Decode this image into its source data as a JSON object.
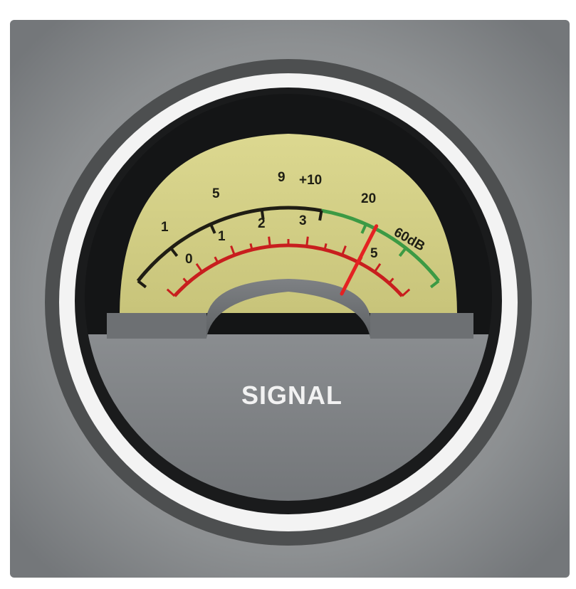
{
  "panel": {
    "caption": "SIGNAL"
  },
  "meter": {
    "db_scale": {
      "labels": [
        "1",
        "5",
        "9",
        "+10",
        "20",
        "60dB"
      ]
    },
    "signal_scale": {
      "labels": [
        "0",
        "1",
        "2",
        "3",
        "5"
      ]
    },
    "needle_level": 0.76
  },
  "colors": {
    "face": "#d9d68a",
    "db_scale_black": "#1f1d14",
    "db_scale_green": "#3c9a44",
    "signal_scale_red": "#c81e1e",
    "needle": "#e42222",
    "bezel_ring": "#f3f3f3",
    "housing": "#8e9193"
  }
}
